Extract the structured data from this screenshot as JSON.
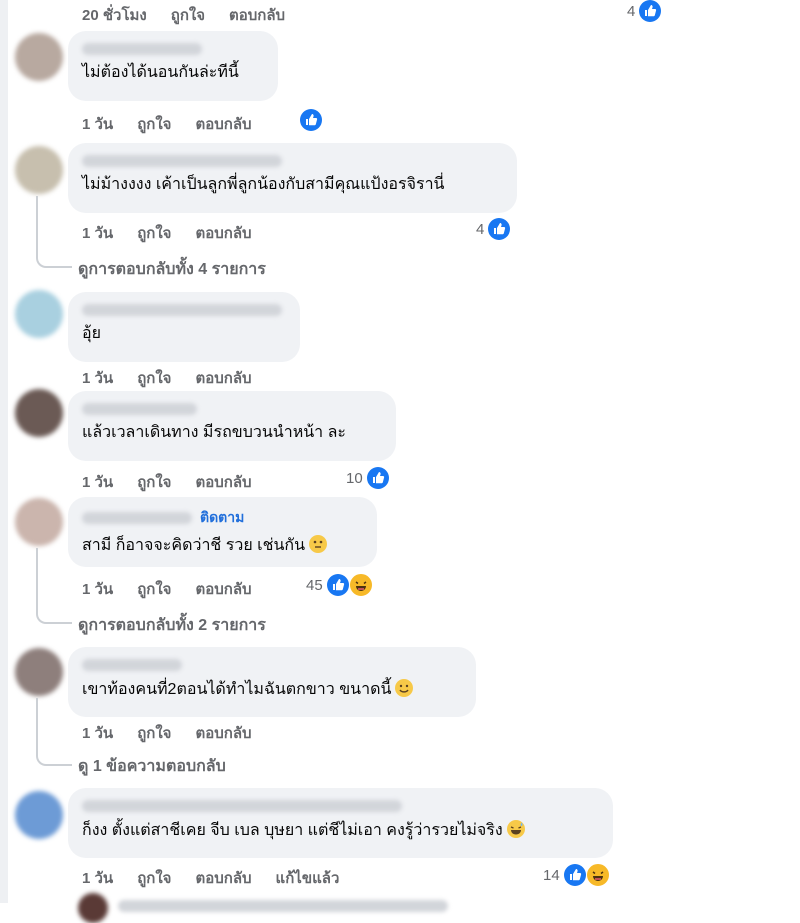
{
  "top_row": {
    "time": "20 ชั่วโมง",
    "like": "ถูกใจ",
    "reply": "ตอบกลับ",
    "reaction_count": "4"
  },
  "comments": [
    {
      "text": "ไม่ต้องได้นอนกันล่ะทีนี้",
      "time": "1 วัน",
      "like": "ถูกใจ",
      "reply": "ตอบกลับ",
      "reaction_count": ""
    },
    {
      "text": "ไม่ม้างงงง เค้าเป็นลูกพี่ลูกน้องกับสามีคุณแป้งอรจิรานี่",
      "time": "1 วัน",
      "like": "ถูกใจ",
      "reply": "ตอบกลับ",
      "reaction_count": "4",
      "replies": "ดูการตอบกลับทั้ง 4 รายการ"
    },
    {
      "text": "อุ้ย",
      "time": "1 วัน",
      "like": "ถูกใจ",
      "reply": "ตอบกลับ"
    },
    {
      "text": "แล้วเวลาเดินทาง มีรถขบวนนำหน้า ละ",
      "time": "1 วัน",
      "like": "ถูกใจ",
      "reply": "ตอบกลับ",
      "reaction_count": "10"
    },
    {
      "follow": "ติดตาม",
      "text": "สามี ก็อาจจะคิดว่าชี รวย เช่นกัน",
      "time": "1 วัน",
      "like": "ถูกใจ",
      "reply": "ตอบกลับ",
      "reaction_count": "45",
      "replies": "ดูการตอบกลับทั้ง 2 รายการ"
    },
    {
      "text": "เขาท้องคนที่2ตอนได้ทำไมฉันตกขาว ขนาดนี้",
      "time": "1 วัน",
      "like": "ถูกใจ",
      "reply": "ตอบกลับ",
      "replies": "ดู 1 ข้อความตอบกลับ"
    },
    {
      "text": "ก็งง ตั้งแต่สาชีเคย จีบ เบล บุษยา แต่ชีไม่เอา คงรู้ว่ารวยไม่จริง",
      "time": "1 วัน",
      "like": "ถูกใจ",
      "reply": "ตอบกลับ",
      "edited": "แก้ไขแล้ว",
      "reaction_count": "14"
    }
  ],
  "icons": {
    "like": "like-icon",
    "laugh": "laugh-icon",
    "thinking": "thinking-emoji",
    "smile": "smile-emoji",
    "grin": "grin-sweat-emoji"
  },
  "colors": {
    "bubble": "#f0f2f5",
    "like_blue": "#1877f2",
    "meta_gray": "#65676b",
    "follow_blue": "#216fdb"
  }
}
